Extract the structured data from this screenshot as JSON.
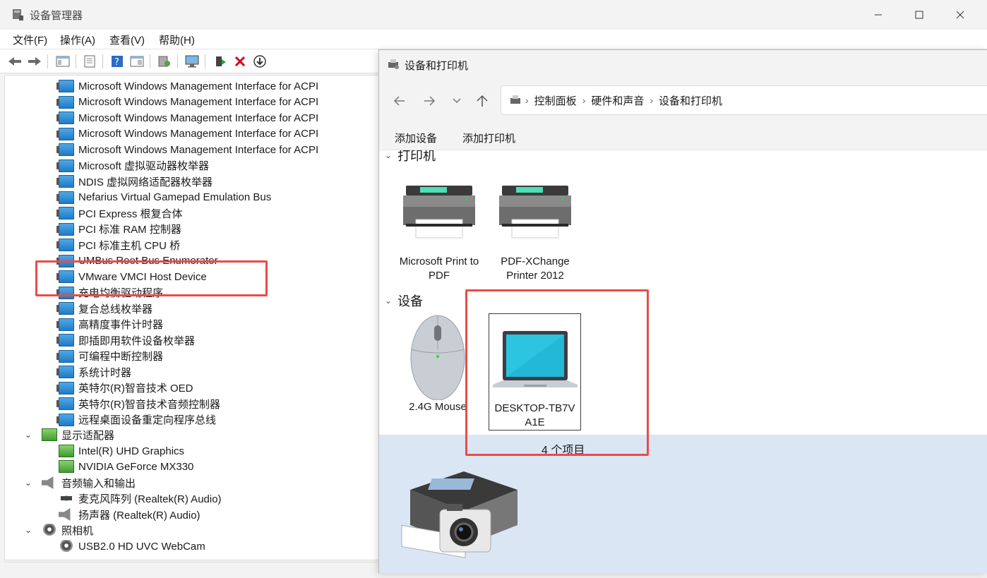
{
  "device_manager": {
    "title": "设备管理器",
    "menu": [
      "文件(F)",
      "操作(A)",
      "查看(V)",
      "帮助(H)"
    ],
    "tree_items": [
      {
        "label": "Microsoft Windows Management Interface for ACPI",
        "icon": "system-device-icon"
      },
      {
        "label": "Microsoft Windows Management Interface for ACPI",
        "icon": "system-device-icon"
      },
      {
        "label": "Microsoft Windows Management Interface for ACPI",
        "icon": "system-device-icon"
      },
      {
        "label": "Microsoft Windows Management Interface for ACPI",
        "icon": "system-device-icon"
      },
      {
        "label": "Microsoft Windows Management Interface for ACPI",
        "icon": "system-device-icon"
      },
      {
        "label": "Microsoft 虚拟驱动器枚举器",
        "icon": "system-device-icon"
      },
      {
        "label": "NDIS 虚拟网络适配器枚举器",
        "icon": "system-device-icon"
      },
      {
        "label": "Nefarius Virtual Gamepad Emulation Bus",
        "icon": "system-device-icon"
      },
      {
        "label": "PCI Express 根复合体",
        "icon": "system-device-icon"
      },
      {
        "label": "PCI 标准 RAM 控制器",
        "icon": "system-device-icon"
      },
      {
        "label": "PCI 标准主机 CPU 桥",
        "icon": "system-device-icon"
      },
      {
        "label": "UMBus Root Bus Enumerator",
        "icon": "system-device-icon"
      },
      {
        "label": "VMware VMCI Host Device",
        "icon": "system-device-icon"
      },
      {
        "label": "充电均衡驱动程序",
        "icon": "system-device-icon"
      },
      {
        "label": "复合总线枚举器",
        "icon": "system-device-icon"
      },
      {
        "label": "高精度事件计时器",
        "icon": "system-device-icon"
      },
      {
        "label": "即插即用软件设备枚举器",
        "icon": "system-device-icon"
      },
      {
        "label": "可编程中断控制器",
        "icon": "system-device-icon"
      },
      {
        "label": "系统计时器",
        "icon": "system-device-icon"
      },
      {
        "label": "英特尔(R)智音技术 OED",
        "icon": "system-device-icon"
      },
      {
        "label": "英特尔(R)智音技术音频控制器",
        "icon": "system-device-icon"
      },
      {
        "label": "远程桌面设备重定向程序总线",
        "icon": "system-device-icon"
      }
    ],
    "categories": {
      "display": {
        "label": "显示适配器",
        "children": [
          "Intel(R) UHD Graphics",
          "NVIDIA GeForce MX330"
        ]
      },
      "audio": {
        "label": "音频输入和输出",
        "children": [
          "麦克风阵列 (Realtek(R) Audio)",
          "扬声器 (Realtek(R) Audio)"
        ]
      },
      "camera": {
        "label": "照相机",
        "children": [
          "USB2.0 HD UVC WebCam"
        ]
      }
    }
  },
  "devices_printers": {
    "title": "设备和打印机",
    "breadcrumb": [
      "控制面板",
      "硬件和声音",
      "设备和打印机"
    ],
    "commands": [
      "添加设备",
      "添加打印机"
    ],
    "groups": {
      "printers": {
        "label": "打印机",
        "items": [
          "Microsoft Print to PDF",
          "PDF-XChange Printer 2012"
        ]
      },
      "devices": {
        "label": "设备",
        "items": [
          "2.4G Mouse",
          "DESKTOP-TB7V A1E"
        ]
      }
    },
    "item_count": "4 个项目"
  },
  "highlight_color": "#e84c4c"
}
